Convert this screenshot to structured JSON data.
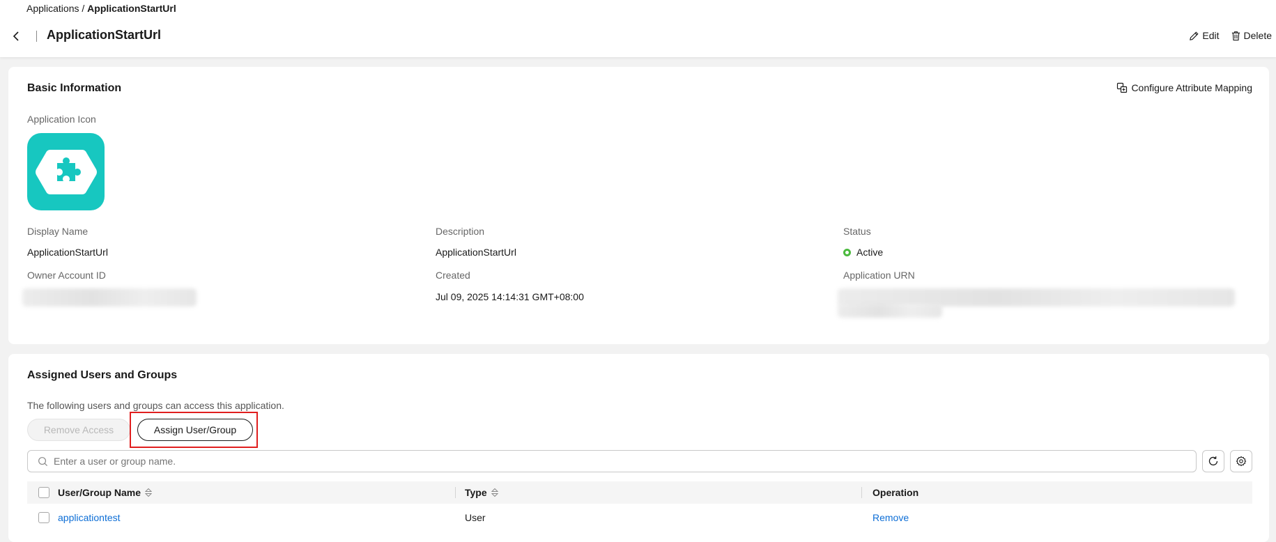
{
  "breadcrumb": {
    "parent": "Applications",
    "separator": " / ",
    "current": "ApplicationStartUrl"
  },
  "header": {
    "title": "ApplicationStartUrl",
    "edit_label": "Edit",
    "delete_label": "Delete"
  },
  "basic_info": {
    "title": "Basic Information",
    "configure_mapping_label": "Configure Attribute Mapping",
    "icon_label": "Application Icon",
    "display_name_label": "Display Name",
    "display_name": "ApplicationStartUrl",
    "description_label": "Description",
    "description": "ApplicationStartUrl",
    "status_label": "Status",
    "status": "Active",
    "owner_label": "Owner Account ID",
    "created_label": "Created",
    "created": "Jul 09, 2025 14:14:31 GMT+08:00",
    "urn_label": "Application URN"
  },
  "assigned": {
    "title": "Assigned Users and Groups",
    "description": "The following users and groups can access this application.",
    "remove_access_label": "Remove Access",
    "assign_label": "Assign User/Group",
    "search_placeholder": "Enter a user or group name.",
    "columns": {
      "name": "User/Group Name",
      "type": "Type",
      "operation": "Operation"
    },
    "rows": [
      {
        "name": "applicationtest",
        "type": "User",
        "operation": "Remove"
      }
    ]
  },
  "colors": {
    "accent_link": "#0d6ed6",
    "icon_bg": "#17c7c0",
    "status_active": "#4cba3f",
    "highlight": "#e01e1e"
  }
}
